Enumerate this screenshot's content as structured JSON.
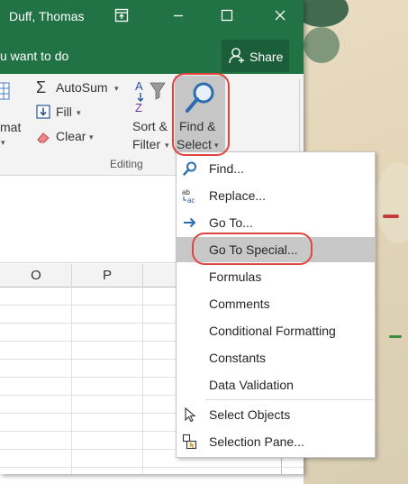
{
  "titlebar": {
    "user": "Duff, Thomas",
    "restore_icon": "ribbon-display-icon",
    "minimize_icon": "minimize-icon",
    "maximize_icon": "maximize-icon",
    "close_icon": "close-icon"
  },
  "tellbar": {
    "text": "u want to do",
    "share_label": "Share"
  },
  "ribbon": {
    "format_label": "mat",
    "autosum_label": "AutoSum",
    "fill_label": "Fill",
    "clear_label": "Clear",
    "sort_filter_line1": "Sort &",
    "sort_filter_line2": "Filter",
    "find_select_line1": "Find &",
    "find_select_line2": "Select",
    "group_label": "Editing"
  },
  "columns": [
    "O",
    "P"
  ],
  "menu": {
    "items": [
      {
        "label": "Find...",
        "icon": "search-icon"
      },
      {
        "label": "Replace...",
        "icon": "replace-icon"
      },
      {
        "label": "Go To...",
        "icon": "arrow-right-icon"
      },
      {
        "label": "Go To Special...",
        "icon": "",
        "highlighted": true
      },
      {
        "label": "Formulas",
        "icon": ""
      },
      {
        "label": "Comments",
        "icon": ""
      },
      {
        "label": "Conditional Formatting",
        "icon": ""
      },
      {
        "label": "Constants",
        "icon": ""
      },
      {
        "label": "Data Validation",
        "icon": ""
      },
      {
        "label": "Select Objects",
        "icon": "cursor-icon"
      },
      {
        "label": "Selection Pane...",
        "icon": "selection-pane-icon"
      }
    ]
  },
  "colors": {
    "titlebar": "#217346",
    "share_button": "#1b5e3a",
    "highlight": "#c8c8c8",
    "annotation_ring": "#e0453f"
  }
}
